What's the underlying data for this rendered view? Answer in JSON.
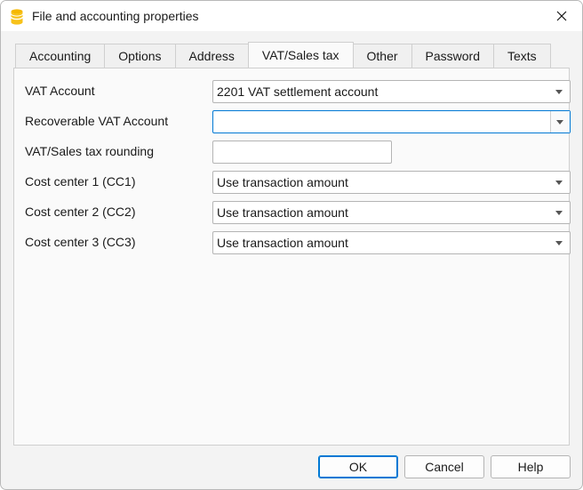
{
  "window": {
    "title": "File and accounting properties"
  },
  "tabs": [
    {
      "label": "Accounting",
      "active": false
    },
    {
      "label": "Options",
      "active": false
    },
    {
      "label": "Address",
      "active": false
    },
    {
      "label": "VAT/Sales tax",
      "active": true
    },
    {
      "label": "Other",
      "active": false
    },
    {
      "label": "Password",
      "active": false
    },
    {
      "label": "Texts",
      "active": false
    }
  ],
  "form": {
    "vat_account": {
      "label": "VAT Account",
      "value": "2201 VAT settlement account"
    },
    "recoverable_vat_account": {
      "label": "Recoverable VAT Account",
      "value": ""
    },
    "vat_rounding": {
      "label": "VAT/Sales tax rounding",
      "value": ""
    },
    "cc1": {
      "label": "Cost center 1 (CC1)",
      "value": "Use transaction amount"
    },
    "cc2": {
      "label": "Cost center 2 (CC2)",
      "value": "Use transaction amount"
    },
    "cc3": {
      "label": "Cost center 3 (CC3)",
      "value": "Use transaction amount"
    }
  },
  "buttons": {
    "ok": "OK",
    "cancel": "Cancel",
    "help": "Help"
  },
  "colors": {
    "accent": "#0078d4",
    "icon_yellow": "#f5b800"
  }
}
